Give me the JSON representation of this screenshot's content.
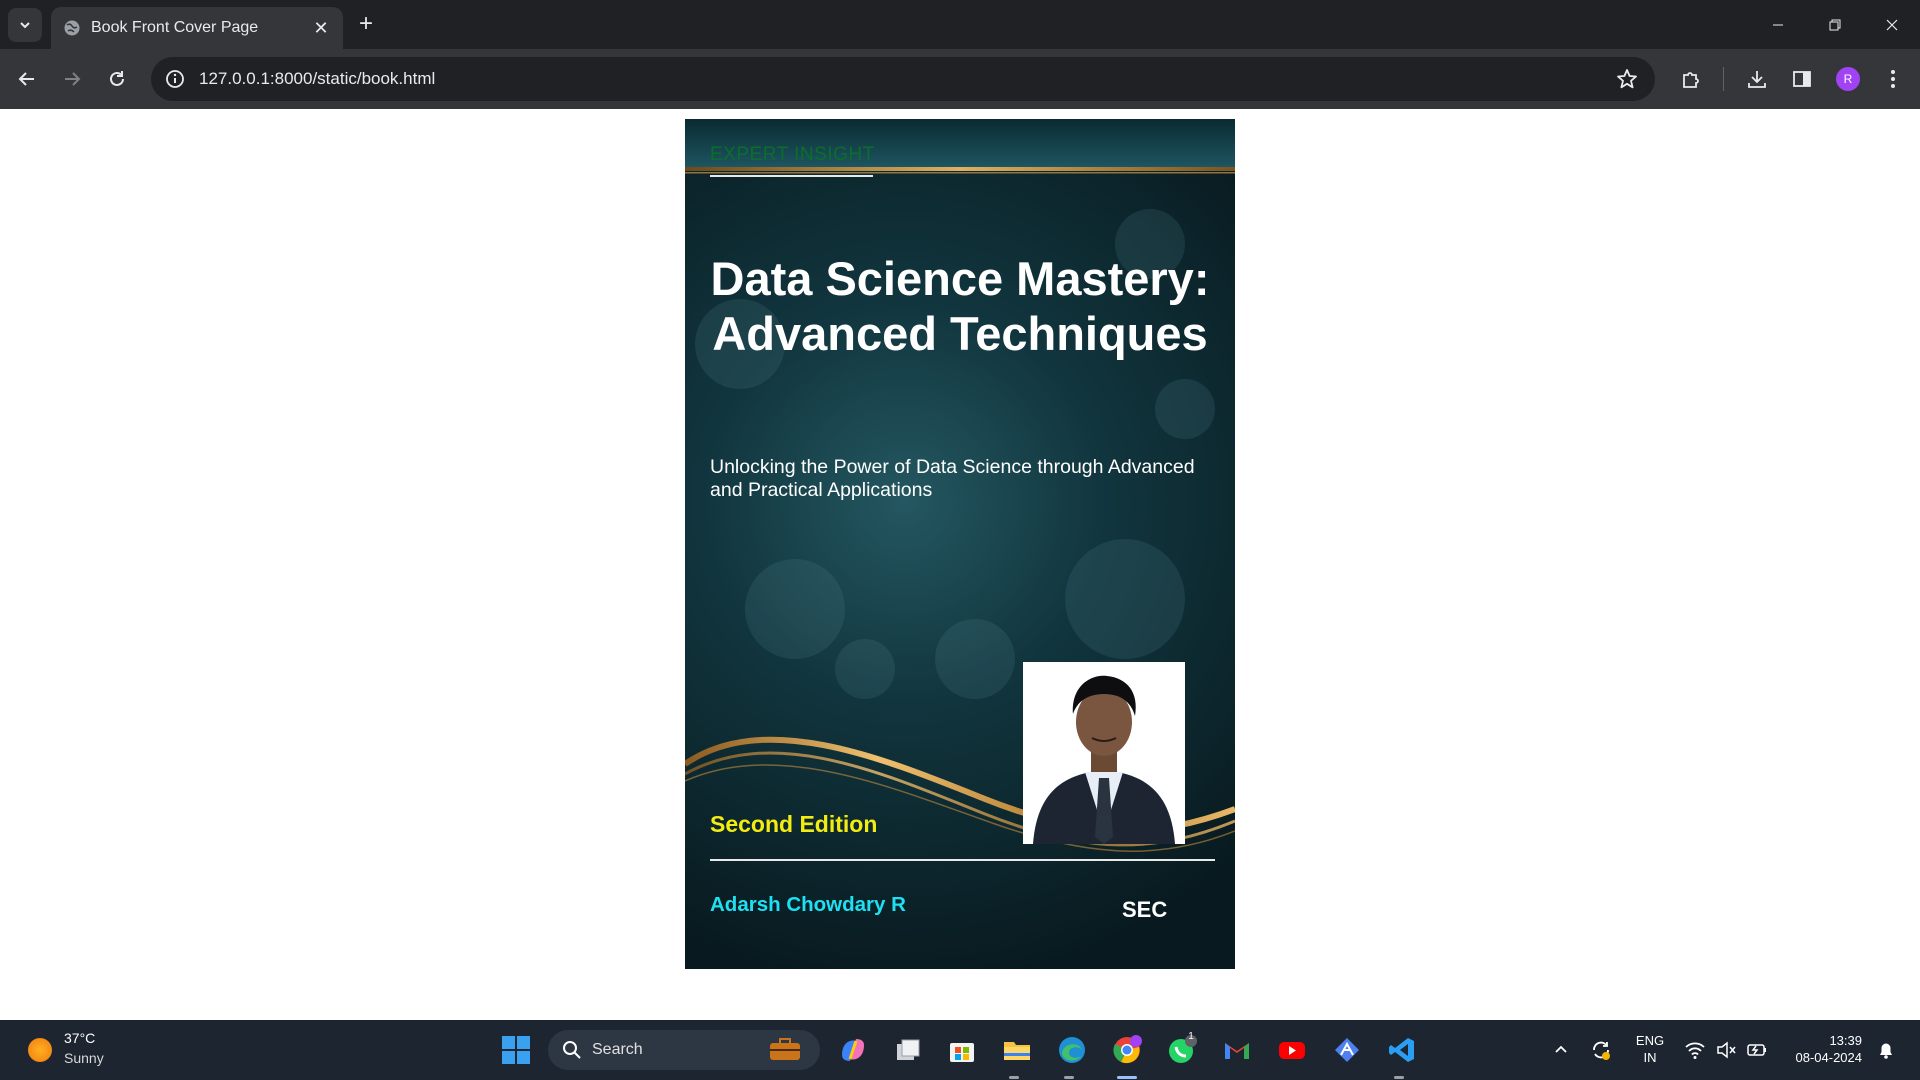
{
  "browser": {
    "tab_title": "Book Front Cover Page",
    "url": "127.0.0.1:8000/static/book.html",
    "profile_initial": "R"
  },
  "cover": {
    "series_label": "EXPERT INSIGHT",
    "title": "Data Science Mastery: Advanced Techniques",
    "subtitle": "Unlocking the Power of Data Science through Advanced and Practical Applications",
    "edition": "Second Edition",
    "author": "Adarsh Chowdary R",
    "publisher": "SEC",
    "colors": {
      "series_label": "#0b6e2a",
      "edition": "#f2ec12",
      "author": "#1fe0f2",
      "background": "#0d2b32"
    }
  },
  "taskbar": {
    "weather_temp": "37°C",
    "weather_desc": "Sunny",
    "search_label": "Search",
    "whatsapp_badge": "1",
    "language": "ENG",
    "region": "IN",
    "time": "13:39",
    "date": "08-04-2024",
    "apps": [
      "start-icon",
      "search-icon",
      "copilot-icon",
      "task-view-icon",
      "store-icon",
      "file-explorer-icon",
      "edge-icon",
      "chrome-icon",
      "whatsapp-icon",
      "gmail-icon",
      "youtube-icon",
      "app-icon",
      "vscode-icon"
    ]
  }
}
